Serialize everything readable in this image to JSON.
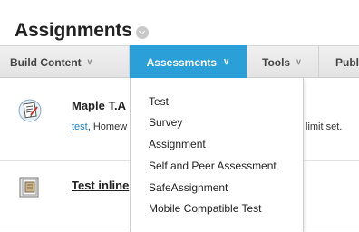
{
  "page": {
    "title": "Assignments"
  },
  "action_bar": {
    "items": [
      {
        "label": "Build Content",
        "chevron": "∨"
      },
      {
        "label": "Assessments",
        "chevron": "∨"
      },
      {
        "label": "Tools",
        "chevron": "∨"
      },
      {
        "label": "Publ"
      }
    ],
    "active_index": 1
  },
  "content_items": [
    {
      "title": "Maple T.A",
      "link_text": "test",
      "meta": ", Homew",
      "meta_right": "limit set.",
      "icon": "test-document-icon"
    },
    {
      "title": "Test inline",
      "icon": "content-file-icon"
    }
  ],
  "dropdown": {
    "items": [
      "Test",
      "Survey",
      "Assignment",
      "Self and Peer Assessment",
      "SafeAssignment",
      "Mobile Compatible Test"
    ]
  },
  "colors": {
    "accent": "#2a9fd8",
    "link": "#1d7fbf"
  }
}
